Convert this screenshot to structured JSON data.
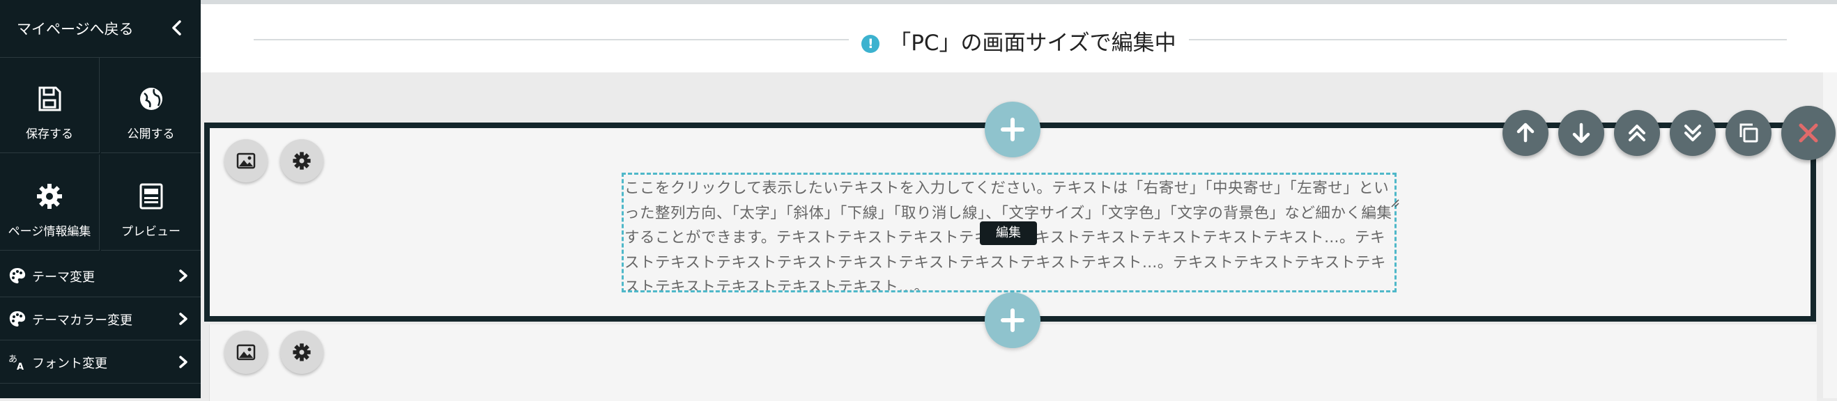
{
  "sidebar": {
    "back_label": "マイページへ戻る",
    "grid": [
      {
        "label": "保存する",
        "icon": "save-icon"
      },
      {
        "label": "公開する",
        "icon": "publish-icon"
      },
      {
        "label": "ページ情報編集",
        "icon": "gear-icon"
      },
      {
        "label": "プレビュー",
        "icon": "preview-icon"
      }
    ],
    "rows": [
      {
        "label": "テーマ変更",
        "icon": "palette-icon"
      },
      {
        "label": "テーマカラー変更",
        "icon": "palette-icon"
      },
      {
        "label": "フォント変更",
        "icon": "font-icon"
      }
    ]
  },
  "header": {
    "title": "「PC」の画面サイズで編集中",
    "warn_glyph": "!"
  },
  "block": {
    "text": "ここをクリックして表示したいテキストを入力してください。テキストは「右寄せ」「中央寄せ」「左寄せ」といった整列方向、「太字」「斜体」「下線」「取り消し線」、「文字サイズ」「文字色」「文字の背景色」など細かく編集することができます。テキストテキストテキストテキストテキストテキストテキストテキストテキスト…。テキストテキストテキストテキストテキストテキストテキストテキストテキスト…。テキストテキストテキストテキストテキストテキストテキストテキスト…。",
    "edit_tooltip": "編集"
  },
  "colors": {
    "sidebar_bg": "#0f1d22",
    "accent": "#3cb2cf",
    "selection_border": "#14262b",
    "close_icon": "#e06a6a"
  }
}
